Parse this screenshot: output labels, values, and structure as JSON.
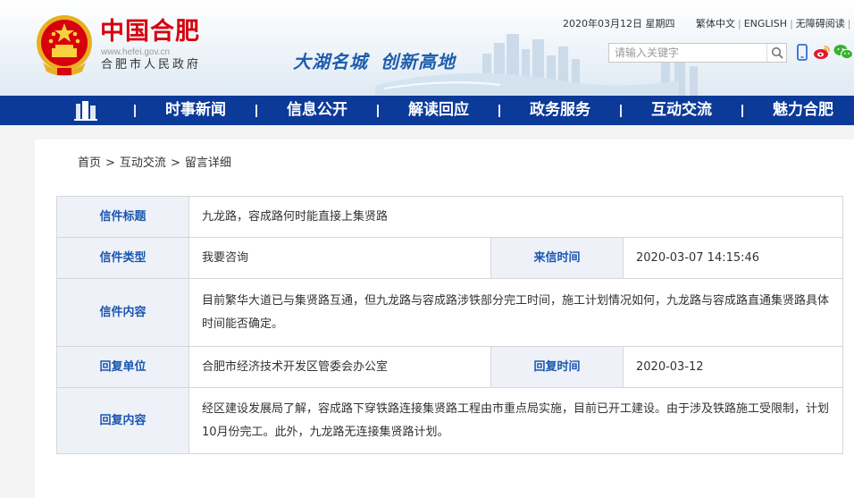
{
  "header": {
    "site_name": "中国合肥",
    "site_url": "www.hefei.gov.cn",
    "site_subtitle": "合肥市人民政府",
    "slogan_1": "大湖名城",
    "slogan_2": "创新高地",
    "date": "2020年03月12日 星期四",
    "links": [
      "繁体中文",
      "ENGLISH",
      "无障碍阅读",
      "登"
    ],
    "search_placeholder": "请输入关键字"
  },
  "colors": {
    "brand_red": "#d7000f",
    "nav_blue": "#0b3a99",
    "label_blue": "#1b56b0",
    "label_bg": "#eef2f8"
  },
  "nav": {
    "items": [
      "时事新闻",
      "信息公开",
      "解读回应",
      "政务服务",
      "互动交流",
      "魅力合肥"
    ]
  },
  "breadcrumb": {
    "home": "首页",
    "section": "互动交流",
    "current": "留言详细",
    "separator": ">"
  },
  "letter": {
    "title_label": "信件标题",
    "title": "九龙路，容成路何时能直接上集贤路",
    "type_label": "信件类型",
    "type": "我要咨询",
    "received_label": "来信时间",
    "received": "2020-03-07 14:15:46",
    "content_label": "信件内容",
    "content": "目前繁华大道已与集贤路互通，但九龙路与容成路涉铁部分完工时间，施工计划情况如何，九龙路与容成路直通集贤路具体时间能否确定。",
    "reply_unit_label": "回复单位",
    "reply_unit": "合肥市经济技术开发区管委会办公室",
    "reply_time_label": "回复时间",
    "reply_time": "2020-03-12",
    "reply_content_label": "回复内容",
    "reply_content": "经区建设发展局了解，容成路下穿铁路连接集贤路工程由市重点局实施，目前已开工建设。由于涉及铁路施工受限制，计划10月份完工。此外，九龙路无连接集贤路计划。"
  }
}
